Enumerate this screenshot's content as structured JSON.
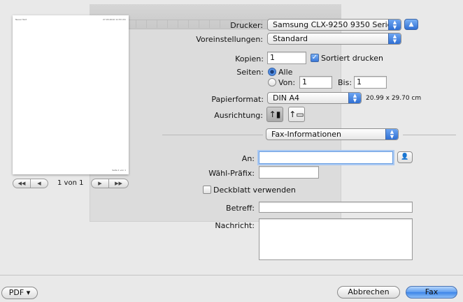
{
  "preview": {
    "header_left": "Neuer Text",
    "header_right": "27.03.2010 11:53 Uhr",
    "footer": "Seite 1 von 1",
    "page_count": "1 von 1",
    "nav_first": "◀◀",
    "nav_prev": "◀",
    "nav_next": "▶",
    "nav_last": "▶▶"
  },
  "printer": {
    "label": "Drucker:",
    "value": "Samsung CLX-9250 9350 Serie…"
  },
  "presets": {
    "label": "Voreinstellungen:",
    "value": "Standard"
  },
  "copies": {
    "label": "Kopien:",
    "value": "1",
    "collate_label": "Sortiert drucken",
    "collate_checked": true
  },
  "pages": {
    "label": "Seiten:",
    "all_label": "Alle",
    "from_label": "Von:",
    "from_value": "1",
    "to_label": "Bis:",
    "to_value": "1"
  },
  "paper": {
    "label": "Papierformat:",
    "value": "DIN A4",
    "size_text": "20.99 x 29.70 cm"
  },
  "orientation": {
    "label": "Ausrichtung:"
  },
  "section": {
    "value": "Fax-Informationen"
  },
  "fax": {
    "to_label": "An:",
    "to_value": "",
    "prefix_label": "Wähl-Präfix:",
    "prefix_value": "",
    "cover_label": "Deckblatt verwenden",
    "subject_label": "Betreff:",
    "subject_value": "",
    "message_label": "Nachricht:",
    "message_value": ""
  },
  "footer": {
    "pdf_label": "PDF ▾",
    "cancel_label": "Abbrechen",
    "fax_label": "Fax"
  },
  "colors": {
    "accent": "#3c84e8",
    "background": "#e9e9e9"
  }
}
